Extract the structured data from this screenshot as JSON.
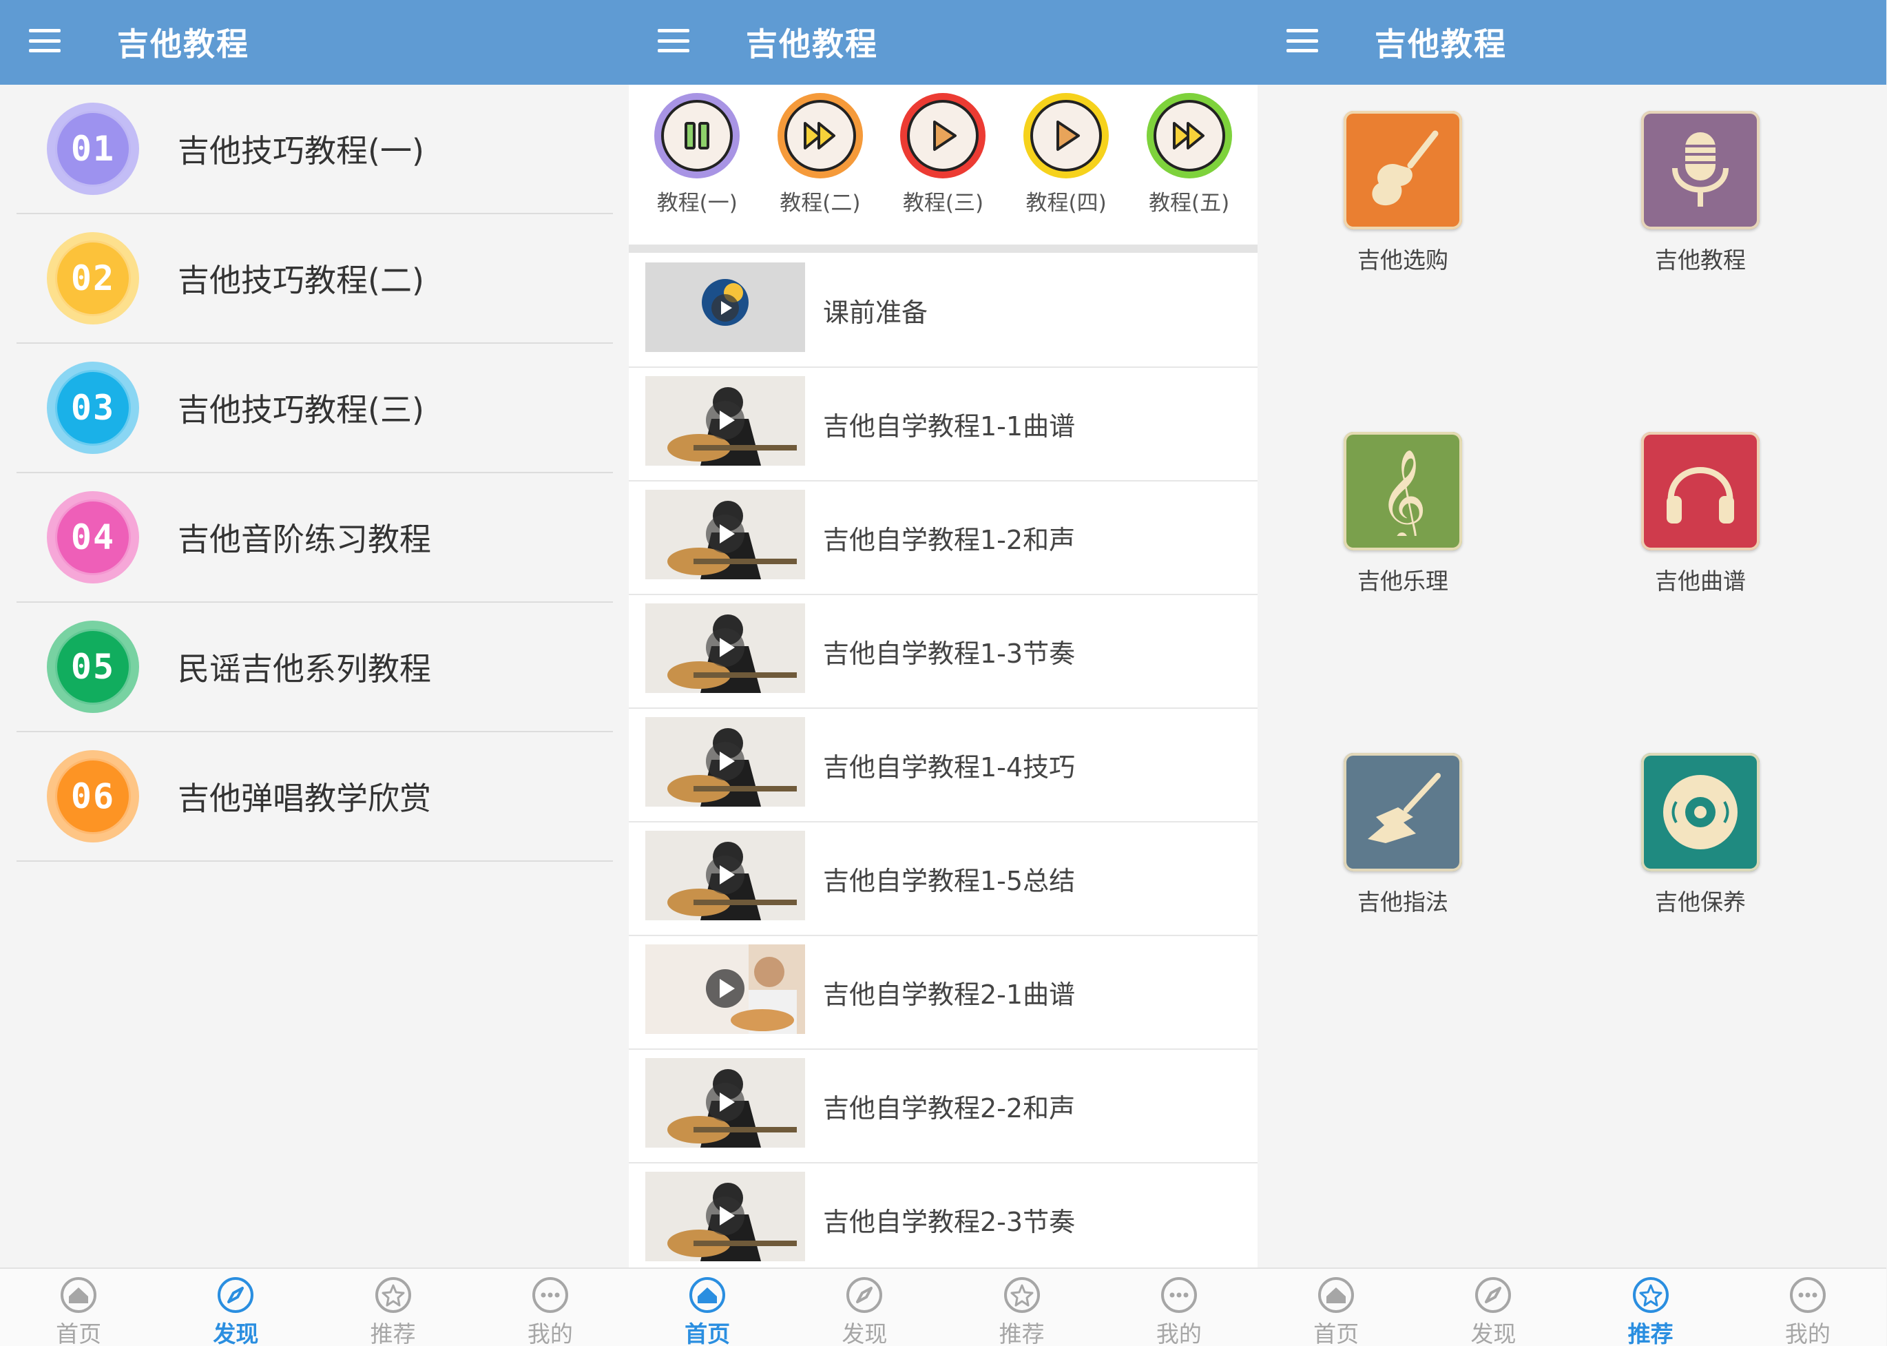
{
  "app_title": "吉他教程",
  "screen1": {
    "items": [
      {
        "num": "01",
        "label": "吉他技巧教程(一)",
        "color": "#9d92ef",
        "ring": "#c3bdf6"
      },
      {
        "num": "02",
        "label": "吉他技巧教程(二)",
        "color": "#fcc23a",
        "ring": "#fde08d"
      },
      {
        "num": "03",
        "label": "吉他技巧教程(三)",
        "color": "#1ab1e8",
        "ring": "#8ad6f3"
      },
      {
        "num": "04",
        "label": "吉他音阶练习教程",
        "color": "#ee5fb8",
        "ring": "#f6a7d8"
      },
      {
        "num": "05",
        "label": "民谣吉他系列教程",
        "color": "#11ad5e",
        "ring": "#78d2a2"
      },
      {
        "num": "06",
        "label": "吉他弹唱教学欣赏",
        "color": "#fd9424",
        "ring": "#fec585"
      }
    ]
  },
  "screen2": {
    "circles": [
      {
        "label": "教程(一)",
        "ring": "#a894e4",
        "icon": "pause-icon"
      },
      {
        "label": "教程(二)",
        "ring": "#f59a3a",
        "icon": "fast-forward-icon"
      },
      {
        "label": "教程(三)",
        "ring": "#ec3b33",
        "icon": "play-icon"
      },
      {
        "label": "教程(四)",
        "ring": "#f6d21c",
        "icon": "play-icon"
      },
      {
        "label": "教程(五)",
        "ring": "#7ed23c",
        "icon": "fast-forward-icon"
      }
    ],
    "videos": [
      {
        "label": "课前准备"
      },
      {
        "label": "吉他自学教程1-1曲谱"
      },
      {
        "label": "吉他自学教程1-2和声"
      },
      {
        "label": "吉他自学教程1-3节奏"
      },
      {
        "label": "吉他自学教程1-4技巧"
      },
      {
        "label": "吉他自学教程1-5总结"
      },
      {
        "label": "吉他自学教程2-1曲谱"
      },
      {
        "label": "吉他自学教程2-2和声"
      },
      {
        "label": "吉他自学教程2-3节奏"
      }
    ]
  },
  "screen3": {
    "tiles": [
      {
        "label": "吉他选购",
        "color": "#ea7f31",
        "icon": "guitar-icon"
      },
      {
        "label": "吉他教程",
        "color": "#8d6b8f",
        "icon": "microphone-icon"
      },
      {
        "label": "吉他乐理",
        "color": "#7aa04c",
        "icon": "treble-clef-icon"
      },
      {
        "label": "吉他曲谱",
        "color": "#cf3b4c",
        "icon": "headphones-icon"
      },
      {
        "label": "吉他指法",
        "color": "#5e7a8d",
        "icon": "electric-guitar-icon"
      },
      {
        "label": "吉他保养",
        "color": "#1f8a80",
        "icon": "disc-icon"
      }
    ]
  },
  "nav": {
    "home": "首页",
    "discover": "发现",
    "recommend": "推荐",
    "mine": "我的",
    "active_color": "#2a8ee0",
    "inactive_color": "#a6a6a6"
  },
  "active_tabs": [
    "discover",
    "home",
    "recommend"
  ]
}
